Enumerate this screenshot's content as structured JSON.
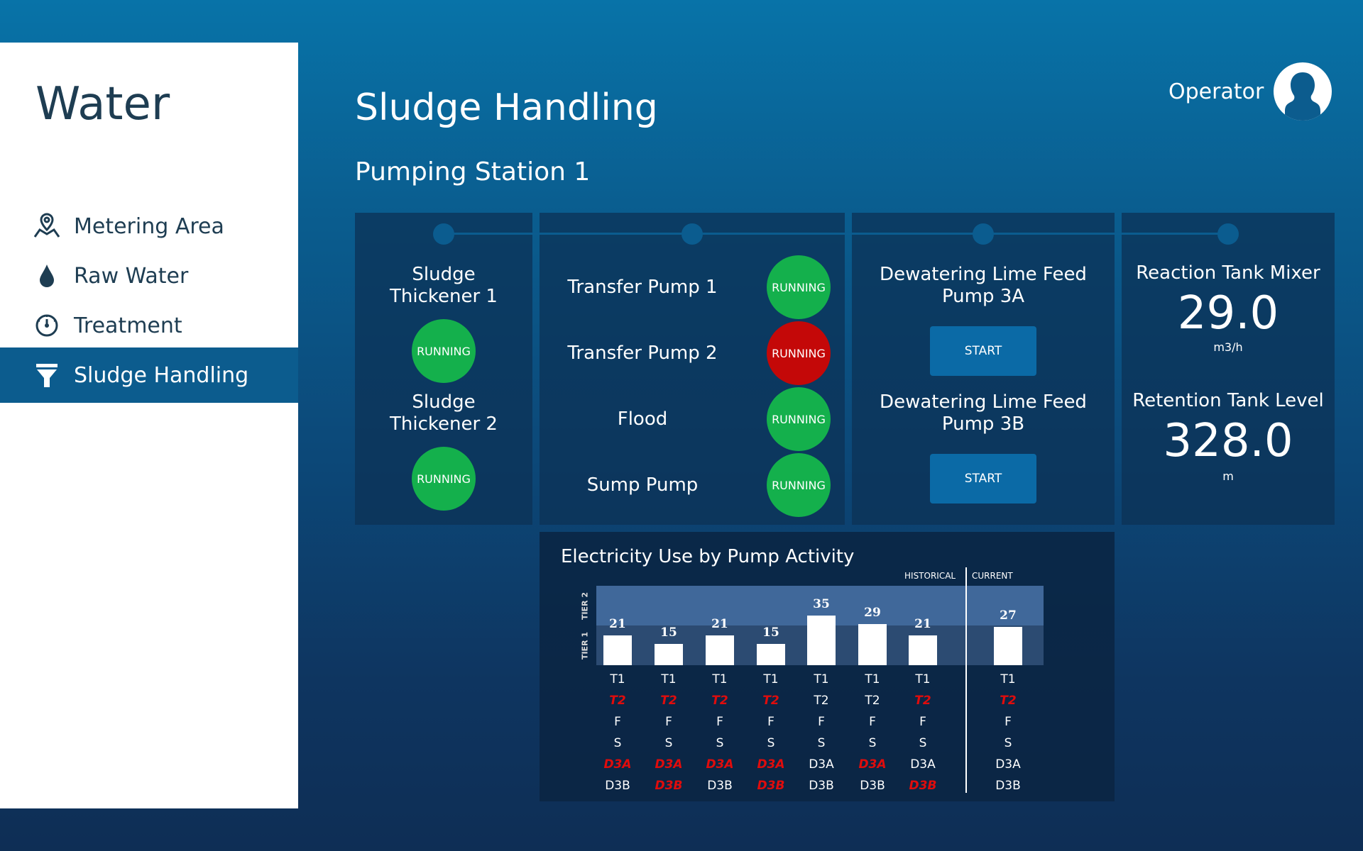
{
  "sidebar": {
    "app_title": "Water",
    "items": [
      {
        "label": "Metering Area",
        "icon": "map-pin-icon"
      },
      {
        "label": "Raw Water",
        "icon": "water-drop-icon"
      },
      {
        "label": "Treatment",
        "icon": "gauge-icon"
      },
      {
        "label": "Sludge Handling",
        "icon": "funnel-icon",
        "active": true
      }
    ]
  },
  "header": {
    "page_title": "Sludge Handling",
    "section_title": "Pumping Station 1",
    "user_label": "Operator"
  },
  "thickeners": [
    {
      "name": "Sludge\nThickener 1",
      "status": "RUNNING",
      "color": "#14b04c"
    },
    {
      "name": "Sludge\nThickener 2",
      "status": "RUNNING",
      "color": "#14b04c"
    }
  ],
  "pumps": [
    {
      "name": "Transfer Pump 1",
      "status": "RUNNING",
      "color": "#14b04c"
    },
    {
      "name": "Transfer Pump 2",
      "status": "RUNNING",
      "color": "#c40808"
    },
    {
      "name": "Flood",
      "status": "RUNNING",
      "color": "#14b04c"
    },
    {
      "name": "Sump Pump",
      "status": "RUNNING",
      "color": "#14b04c"
    }
  ],
  "lime_feed": [
    {
      "name": "Dewatering Lime Feed\nPump 3A",
      "button": "START"
    },
    {
      "name": "Dewatering Lime Feed\nPump 3B",
      "button": "START"
    }
  ],
  "metrics": [
    {
      "label": "Reaction Tank Mixer",
      "value": "29.0",
      "unit": "m3/h"
    },
    {
      "label": "Retention Tank Level",
      "value": "328.0",
      "unit": "m"
    }
  ],
  "chart_data": {
    "type": "bar",
    "title": "Electricity Use by Pump Activity",
    "header_historical": "HISTORICAL",
    "header_current": "CURRENT",
    "tier_labels": [
      "TIER 2",
      "TIER 1"
    ],
    "values": [
      21,
      15,
      21,
      15,
      35,
      29,
      21,
      27
    ],
    "segments": [
      "historical",
      "historical",
      "historical",
      "historical",
      "historical",
      "historical",
      "historical",
      "current"
    ],
    "row_labels": [
      "T1",
      "T2",
      "F",
      "S",
      "D3A",
      "D3B"
    ],
    "rows": [
      [
        {
          "t": "T1",
          "a": false
        },
        {
          "t": "T2",
          "a": true
        },
        {
          "t": "F",
          "a": false
        },
        {
          "t": "S",
          "a": false
        },
        {
          "t": "D3A",
          "a": true
        },
        {
          "t": "D3B",
          "a": false
        }
      ],
      [
        {
          "t": "T1",
          "a": false
        },
        {
          "t": "T2",
          "a": true
        },
        {
          "t": "F",
          "a": false
        },
        {
          "t": "S",
          "a": false
        },
        {
          "t": "D3A",
          "a": true
        },
        {
          "t": "D3B",
          "a": true
        }
      ],
      [
        {
          "t": "T1",
          "a": false
        },
        {
          "t": "T2",
          "a": true
        },
        {
          "t": "F",
          "a": false
        },
        {
          "t": "S",
          "a": false
        },
        {
          "t": "D3A",
          "a": true
        },
        {
          "t": "D3B",
          "a": false
        }
      ],
      [
        {
          "t": "T1",
          "a": false
        },
        {
          "t": "T2",
          "a": true
        },
        {
          "t": "F",
          "a": false
        },
        {
          "t": "S",
          "a": false
        },
        {
          "t": "D3A",
          "a": true
        },
        {
          "t": "D3B",
          "a": true
        }
      ],
      [
        {
          "t": "T1",
          "a": false
        },
        {
          "t": "T2",
          "a": false
        },
        {
          "t": "F",
          "a": false
        },
        {
          "t": "S",
          "a": false
        },
        {
          "t": "D3A",
          "a": false
        },
        {
          "t": "D3B",
          "a": false
        }
      ],
      [
        {
          "t": "T1",
          "a": false
        },
        {
          "t": "T2",
          "a": false
        },
        {
          "t": "F",
          "a": false
        },
        {
          "t": "S",
          "a": false
        },
        {
          "t": "D3A",
          "a": true
        },
        {
          "t": "D3B",
          "a": false
        }
      ],
      [
        {
          "t": "T1",
          "a": false
        },
        {
          "t": "T2",
          "a": true
        },
        {
          "t": "F",
          "a": false
        },
        {
          "t": "S",
          "a": false
        },
        {
          "t": "D3A",
          "a": false
        },
        {
          "t": "D3B",
          "a": true
        }
      ],
      [
        {
          "t": "T1",
          "a": false
        },
        {
          "t": "T2",
          "a": true
        },
        {
          "t": "F",
          "a": false
        },
        {
          "t": "S",
          "a": false
        },
        {
          "t": "D3A",
          "a": false
        },
        {
          "t": "D3B",
          "a": false
        }
      ]
    ],
    "alert_color": "#e00c0c"
  }
}
